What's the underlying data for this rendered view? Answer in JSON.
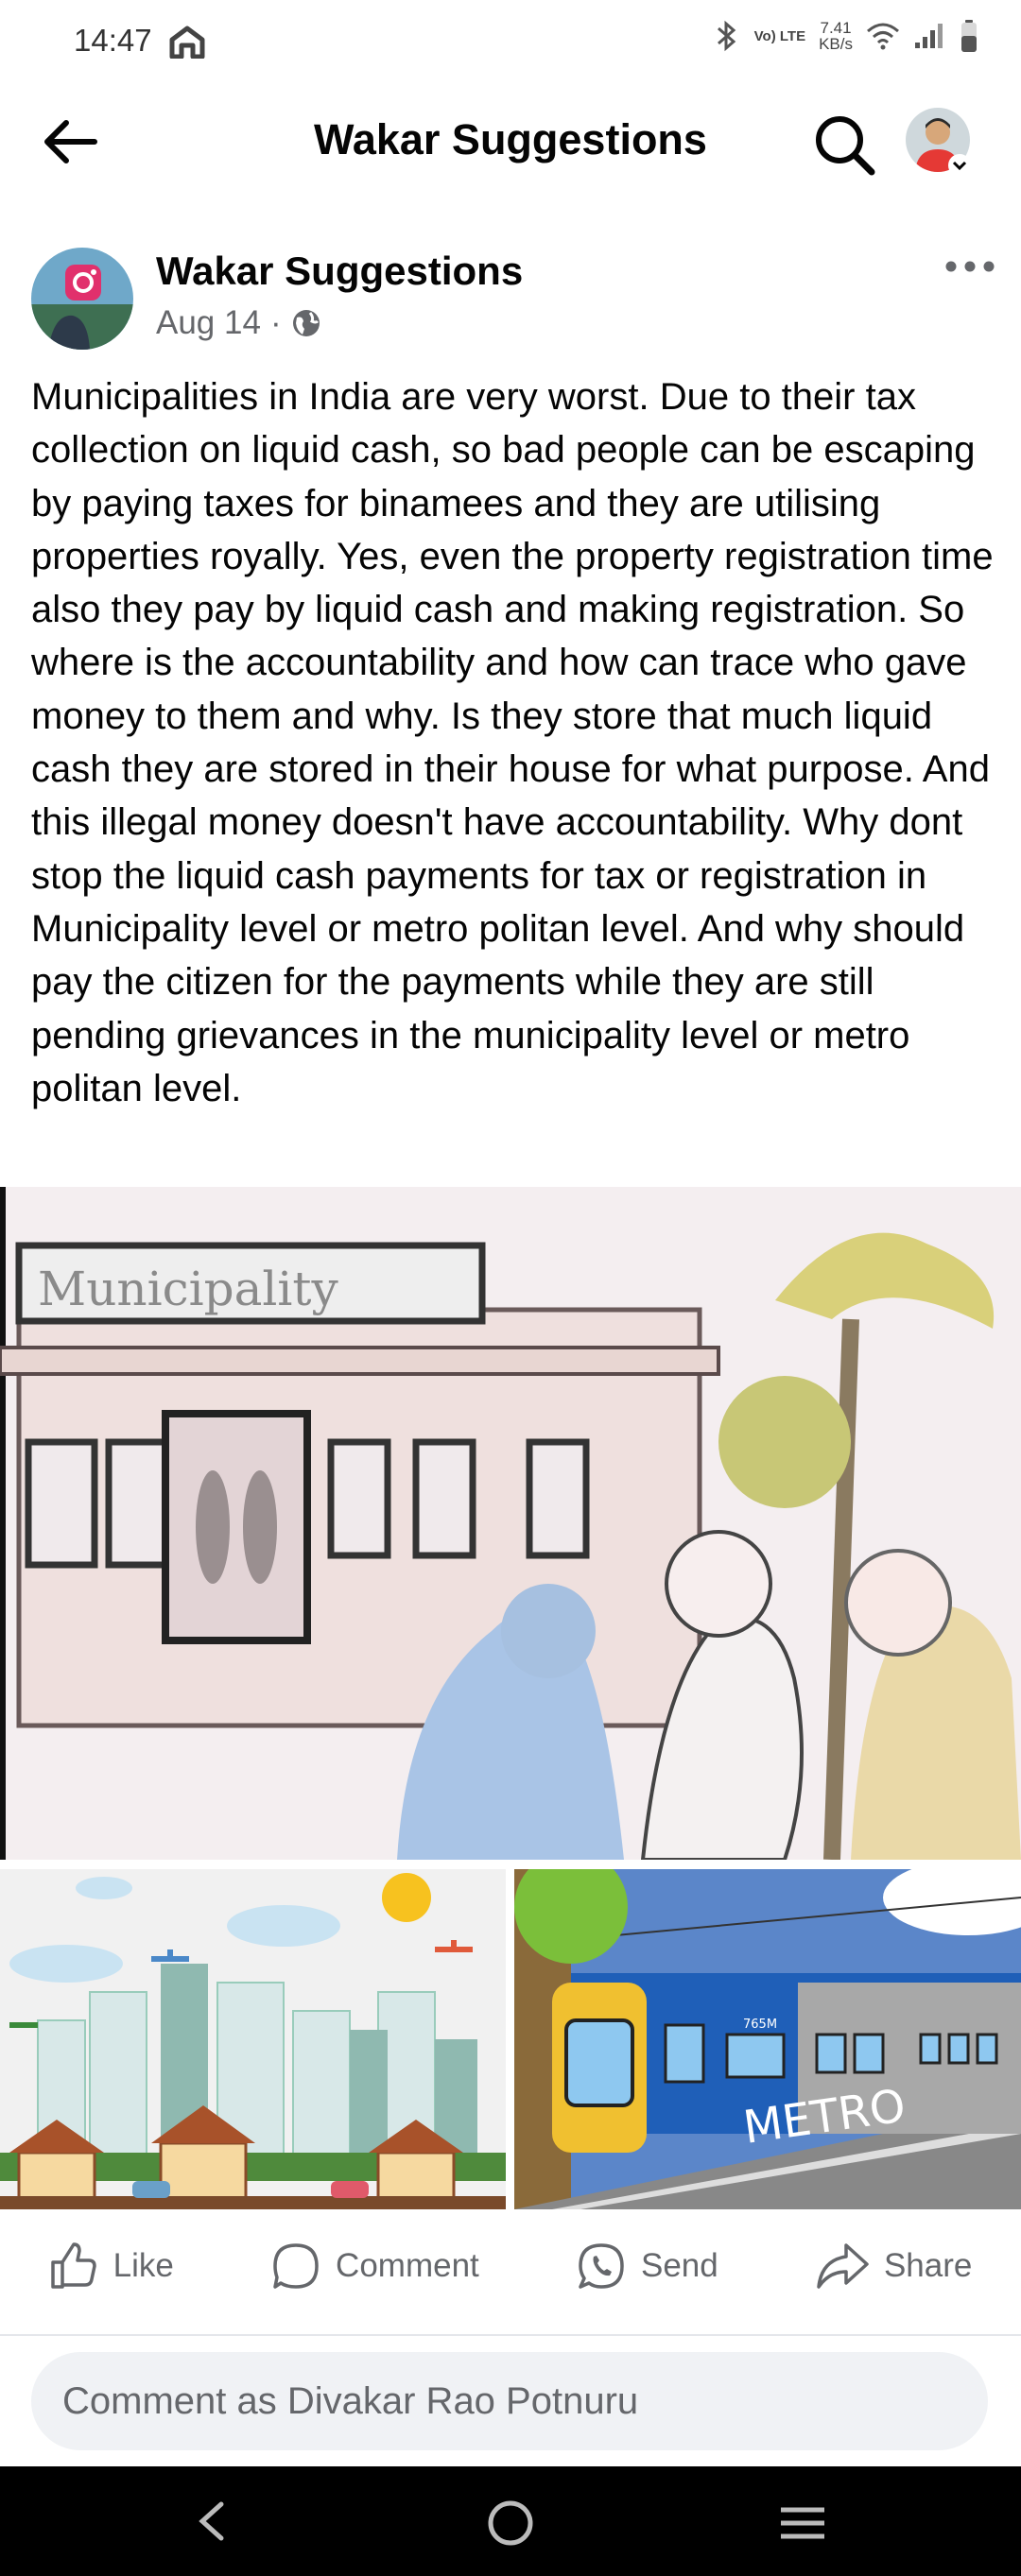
{
  "status_bar": {
    "time": "14:47",
    "network_type": "Vo) LTE",
    "speed_value": "7.41",
    "speed_unit": "KB/s"
  },
  "header": {
    "title": "Wakar Suggestions"
  },
  "post": {
    "author": "Wakar Suggestions",
    "date": "Aug 14",
    "separator": "·",
    "text": "Municipalities in India are very worst. Due to their tax collection on liquid cash, so bad people can be escaping by paying taxes for binamees and they are utilising properties royally. Yes, even the property registration time also they pay by liquid cash and making registration. So where is the accountability and how can trace who gave money to them and why. Is they store that much liquid cash they are stored in their house for what purpose. And this illegal money doesn't have accountability. Why dont stop the liquid cash payments for tax or registration in Municipality level or metro politan level. And why should pay the citizen for the payments while they are still pending grievances in the municipality level or metro politan level.",
    "image_main_sign": "Municipality",
    "image_right_sign": "METRO",
    "image_right_code": "765M"
  },
  "actions": {
    "like": "Like",
    "comment": "Comment",
    "send": "Send",
    "share": "Share"
  },
  "comment_box": {
    "placeholder": "Comment as Divakar Rao Potnuru"
  },
  "icons": {
    "back": "back-arrow-icon",
    "search": "search-icon",
    "more": "more-dots-icon",
    "globe": "globe-icon"
  }
}
